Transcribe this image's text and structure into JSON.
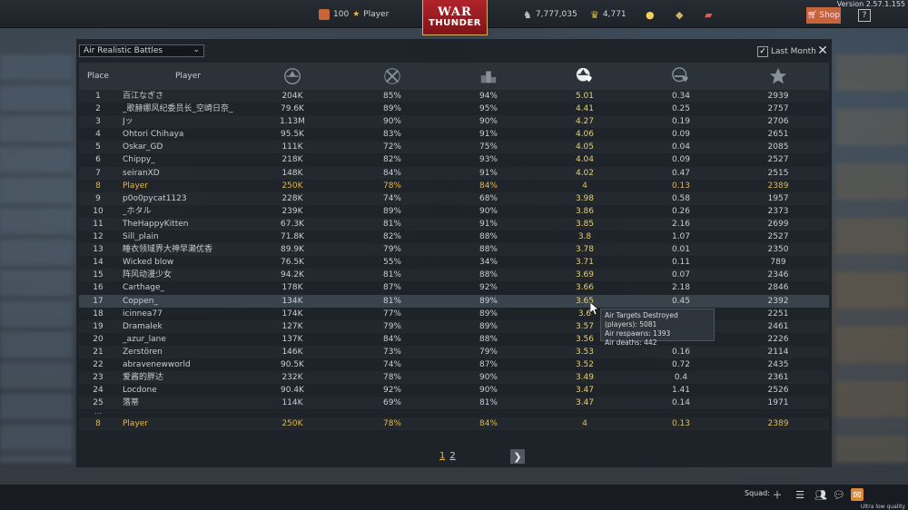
{
  "app": {
    "version": "Version 2.57.1.155"
  },
  "topbar": {
    "rank_value": "100",
    "player_name": "Player",
    "logo_line1": "WAR",
    "logo_line2": "THUNDER",
    "silver_lions": "7,777,035",
    "golden_eagles": "4,771",
    "shop_label": "Shop",
    "help_label": "?"
  },
  "filters": {
    "game_mode": "Air Realistic Battles",
    "period_label": "Last Month",
    "period_checked": true
  },
  "table": {
    "headers": {
      "place": "Place",
      "player": "Player",
      "kills_icon": "aircraft-kills-icon",
      "kill_pct_icon": "crossed-swords-icon",
      "win_pct_icon": "podium-icon",
      "air_dr_icon": "air-targets-per-death-icon",
      "ground_dr_icon": "ground-targets-per-death-icon",
      "score_icon": "star-icon"
    },
    "rows": [
      {
        "place": "1",
        "player": "百江なぎさ",
        "kills": "204K",
        "kpct": "85%",
        "wpct": "94%",
        "adr": "5.01",
        "gdr": "0.34",
        "score": "2939"
      },
      {
        "place": "2",
        "player": "_歌赫娜风纪委员长_空崎日奈_",
        "kills": "79.6K",
        "kpct": "89%",
        "wpct": "95%",
        "adr": "4.41",
        "gdr": "0.25",
        "score": "2757"
      },
      {
        "place": "3",
        "player": "Jッ",
        "kills": "1.13M",
        "kpct": "90%",
        "wpct": "90%",
        "adr": "4.27",
        "gdr": "0.19",
        "score": "2706"
      },
      {
        "place": "4",
        "player": "Ohtori Chihaya",
        "kills": "95.5K",
        "kpct": "83%",
        "wpct": "91%",
        "adr": "4.06",
        "gdr": "0.09",
        "score": "2651"
      },
      {
        "place": "5",
        "player": "Oskar_GD",
        "kills": "111K",
        "kpct": "72%",
        "wpct": "75%",
        "adr": "4.05",
        "gdr": "0.04",
        "score": "2085"
      },
      {
        "place": "6",
        "player": "Chippy_",
        "kills": "218K",
        "kpct": "82%",
        "wpct": "93%",
        "adr": "4.04",
        "gdr": "0.09",
        "score": "2527"
      },
      {
        "place": "7",
        "player": "seiranXD",
        "kills": "148K",
        "kpct": "84%",
        "wpct": "91%",
        "adr": "4.02",
        "gdr": "0.47",
        "score": "2515"
      },
      {
        "place": "8",
        "player": "Player",
        "kills": "250K",
        "kpct": "78%",
        "wpct": "84%",
        "adr": "4",
        "gdr": "0.13",
        "score": "2389",
        "me": true
      },
      {
        "place": "9",
        "player": "p0o0pycat1123",
        "kills": "228K",
        "kpct": "74%",
        "wpct": "68%",
        "adr": "3.98",
        "gdr": "0.58",
        "score": "1957"
      },
      {
        "place": "10",
        "player": "_ホタル",
        "kills": "239K",
        "kpct": "89%",
        "wpct": "90%",
        "adr": "3.86",
        "gdr": "0.26",
        "score": "2373"
      },
      {
        "place": "11",
        "player": "TheHappyKitten",
        "kills": "67.3K",
        "kpct": "81%",
        "wpct": "91%",
        "adr": "3.85",
        "gdr": "2.16",
        "score": "2699"
      },
      {
        "place": "12",
        "player": "Sill_plain",
        "kills": "71.8K",
        "kpct": "82%",
        "wpct": "88%",
        "adr": "3.8",
        "gdr": "1.07",
        "score": "2527"
      },
      {
        "place": "13",
        "player": "睡衣领域界大神早濑优香",
        "kills": "89.9K",
        "kpct": "79%",
        "wpct": "88%",
        "adr": "3.78",
        "gdr": "0.01",
        "score": "2350"
      },
      {
        "place": "14",
        "player": "Wicked blow",
        "kills": "76.5K",
        "kpct": "55%",
        "wpct": "34%",
        "adr": "3.71",
        "gdr": "0.11",
        "score": "789"
      },
      {
        "place": "15",
        "player": "阵风动漫少女",
        "kills": "94.2K",
        "kpct": "81%",
        "wpct": "88%",
        "adr": "3.69",
        "gdr": "0.07",
        "score": "2346"
      },
      {
        "place": "16",
        "player": "Carthage_",
        "kills": "178K",
        "kpct": "87%",
        "wpct": "92%",
        "adr": "3.66",
        "gdr": "2.18",
        "score": "2846"
      },
      {
        "place": "17",
        "player": "Coppen_",
        "kills": "134K",
        "kpct": "81%",
        "wpct": "89%",
        "adr": "3.65",
        "gdr": "0.45",
        "score": "2392",
        "hover": true
      },
      {
        "place": "18",
        "player": "icinnea77",
        "kills": "174K",
        "kpct": "77%",
        "wpct": "89%",
        "adr": "3.6",
        "gdr": "",
        "score": "2251"
      },
      {
        "place": "19",
        "player": "Dramalek",
        "kills": "127K",
        "kpct": "79%",
        "wpct": "89%",
        "adr": "3.57",
        "gdr": "",
        "score": "2461"
      },
      {
        "place": "20",
        "player": "_azur_lane",
        "kills": "137K",
        "kpct": "84%",
        "wpct": "88%",
        "adr": "3.56",
        "gdr": "",
        "score": "2226"
      },
      {
        "place": "21",
        "player": "Zerstören",
        "kills": "146K",
        "kpct": "73%",
        "wpct": "79%",
        "adr": "3.53",
        "gdr": "0.16",
        "score": "2114"
      },
      {
        "place": "22",
        "player": "abravenewworld",
        "kills": "90.5K",
        "kpct": "74%",
        "wpct": "87%",
        "adr": "3.52",
        "gdr": "0.72",
        "score": "2435"
      },
      {
        "place": "23",
        "player": "爱酱的胖达",
        "kills": "232K",
        "kpct": "78%",
        "wpct": "90%",
        "adr": "3.49",
        "gdr": "0.4",
        "score": "2361"
      },
      {
        "place": "24",
        "player": "Locdone",
        "kills": "90.4K",
        "kpct": "92%",
        "wpct": "90%",
        "adr": "3.47",
        "gdr": "1.41",
        "score": "2526"
      },
      {
        "place": "25",
        "player": "落蒂",
        "kills": "114K",
        "kpct": "69%",
        "wpct": "81%",
        "adr": "3.47",
        "gdr": "0.14",
        "score": "1971"
      }
    ],
    "ellipsis": "...",
    "own_row": {
      "place": "8",
      "player": "Player",
      "kills": "250K",
      "kpct": "78%",
      "wpct": "84%",
      "adr": "4",
      "gdr": "0.13",
      "score": "2389"
    }
  },
  "tooltip": {
    "line1": "Air Targets Destroyed (players): 5081",
    "line2": "Air respawns: 1393",
    "line3": "Air deaths: 442"
  },
  "pagination": {
    "current": "1",
    "other": "2",
    "next_icon": "chevron-right-icon"
  },
  "bottombar": {
    "squad_label": "Squad:",
    "quality_label": "Ultra low quality"
  },
  "colors": {
    "accent": "#e3b84f",
    "shop": "#c8643a",
    "logo": "#b0232a"
  }
}
